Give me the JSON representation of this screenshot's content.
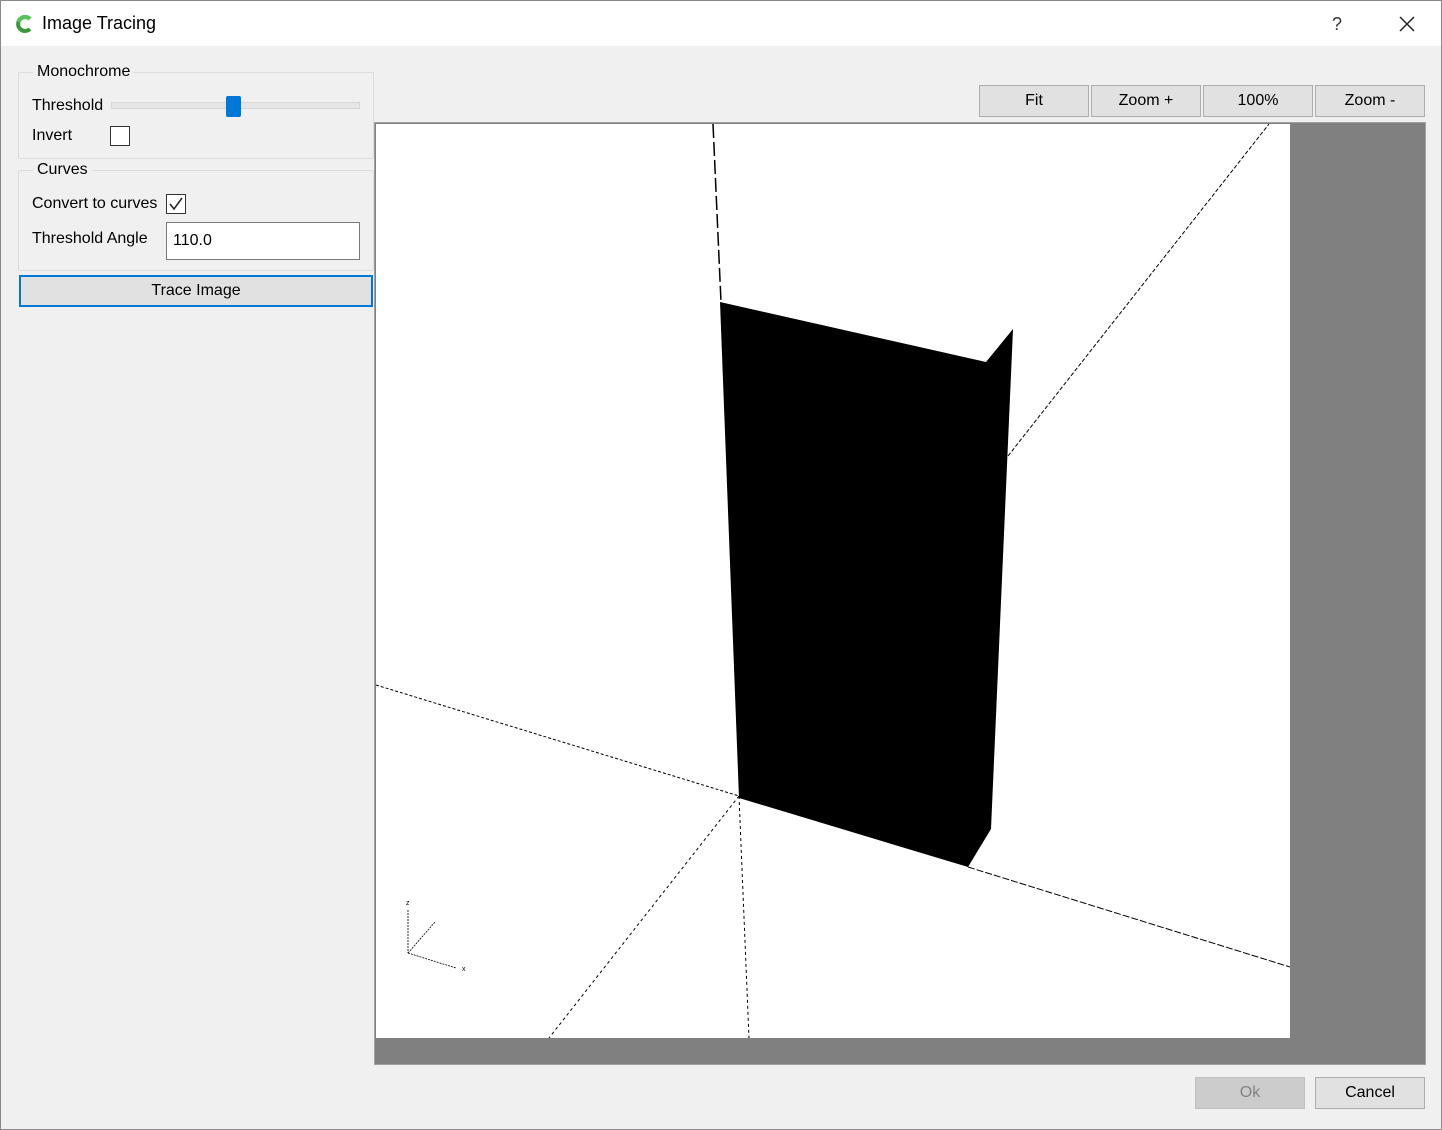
{
  "window": {
    "title": "Image Tracing",
    "help_label": "?",
    "accent_color": "#0078d7",
    "icons": {
      "app": "app-logo-icon",
      "close": "close-icon"
    }
  },
  "monochrome": {
    "legend": "Monochrome",
    "threshold_label": "Threshold",
    "threshold_value_fraction": 0.49,
    "invert_label": "Invert",
    "invert_checked": false
  },
  "curves": {
    "legend": "Curves",
    "convert_label": "Convert to curves",
    "convert_checked": true,
    "angle_label": "Threshold Angle",
    "angle_value": "110.0"
  },
  "trace_button": "Trace Image",
  "zoom": {
    "fit": "Fit",
    "zoom_in": "Zoom +",
    "actual": "100%",
    "zoom_out": "Zoom -"
  },
  "preview": {
    "axis_labels": {
      "z": "z",
      "x": "x"
    }
  },
  "footer": {
    "ok": "Ok",
    "ok_enabled": false,
    "cancel": "Cancel"
  }
}
